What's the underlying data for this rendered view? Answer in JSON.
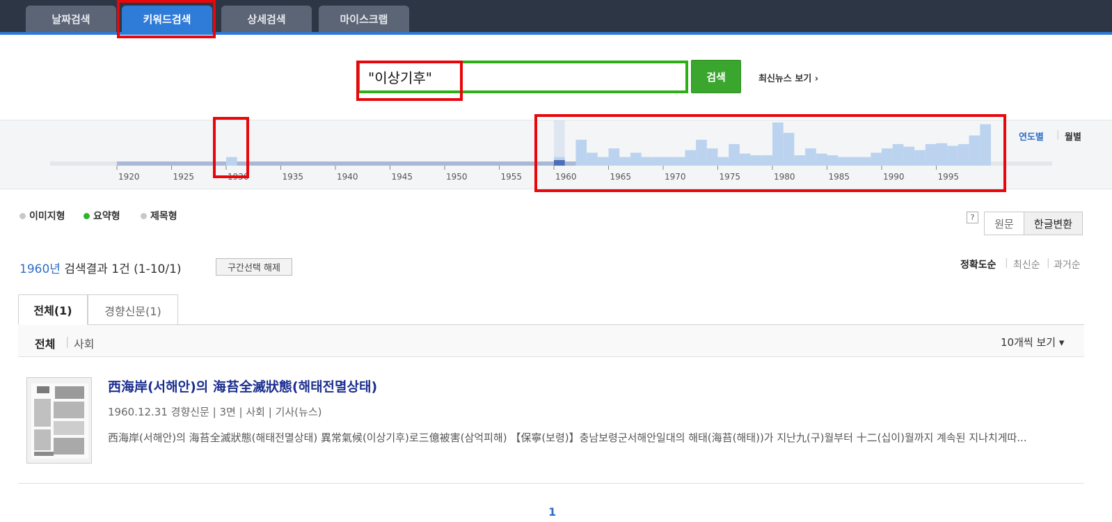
{
  "tabs": [
    {
      "label": "날짜검색"
    },
    {
      "label": "키워드검색"
    },
    {
      "label": "상세검색"
    },
    {
      "label": "마이스크랩"
    }
  ],
  "search": {
    "value": "\"이상기후\"",
    "button_label": "검색",
    "latest_link": "최신뉴스 보기 ›"
  },
  "timeline_toggle": {
    "yearly": "연도별",
    "monthly": "월별",
    "separator": "|"
  },
  "chart_data": {
    "type": "bar",
    "x": [
      1921,
      1922,
      1923,
      1924,
      1925,
      1926,
      1927,
      1928,
      1929,
      1930,
      1931,
      1932,
      1933,
      1934,
      1935,
      1936,
      1937,
      1938,
      1939,
      1940,
      1941,
      1942,
      1943,
      1944,
      1945,
      1946,
      1947,
      1948,
      1949,
      1950,
      1951,
      1952,
      1953,
      1954,
      1955,
      1956,
      1957,
      1958,
      1959,
      1960,
      1961,
      1962,
      1963,
      1964,
      1965,
      1966,
      1967,
      1968,
      1969,
      1970,
      1971,
      1972,
      1973,
      1974,
      1975,
      1976,
      1977,
      1978,
      1979,
      1980,
      1981,
      1982,
      1983,
      1984,
      1985,
      1986,
      1987,
      1988,
      1989,
      1990,
      1991,
      1992,
      1993,
      1994,
      1995,
      1996,
      1997,
      1998,
      1999
    ],
    "values": [
      0,
      0,
      0,
      0,
      0,
      0,
      0,
      0,
      0,
      1,
      0,
      0,
      0,
      0,
      0,
      0,
      0,
      0,
      0,
      0,
      0,
      0,
      0,
      0,
      0,
      0,
      0,
      0,
      0,
      0,
      0,
      0,
      0,
      0,
      0,
      0,
      0,
      0,
      0,
      1,
      0,
      3,
      1.5,
      1,
      2,
      1,
      1.5,
      1,
      1,
      1,
      1,
      1.8,
      3,
      2,
      1,
      2.5,
      1.4,
      1.2,
      1.2,
      5,
      3.8,
      1.2,
      2,
      1.4,
      1.2,
      1,
      1,
      1,
      1.5,
      2,
      2.5,
      2.2,
      1.8,
      2.5,
      2.6,
      2.3,
      2.5,
      3.5,
      4.8,
      3.6
    ],
    "selected_year": 1960,
    "tick_labels": [
      "1920",
      "1925",
      "1930",
      "1935",
      "1940",
      "1945",
      "1950",
      "1955",
      "1960",
      "1965",
      "1970",
      "1975",
      "1980",
      "1985",
      "1990",
      "1995"
    ],
    "xlim": [
      1920,
      2000
    ],
    "ylim": [
      0,
      5
    ],
    "bar_color": "#bcd3ef",
    "selected_color": "#4c6fb8"
  },
  "view_modes": [
    {
      "label": "이미지형",
      "selected": false
    },
    {
      "label": "요약형",
      "selected": true
    },
    {
      "label": "제목형",
      "selected": false
    }
  ],
  "help_label": "?",
  "text_mode": {
    "original": "원문",
    "hangul": "한글변환"
  },
  "results": {
    "year": "1960년",
    "summary": "검색결과 1건 (1-10/1)",
    "reset_label": "구간선택 해제"
  },
  "sort": {
    "accuracy": "정확도순",
    "latest": "최신순",
    "oldest": "과거순",
    "separator": "|"
  },
  "content_tabs": [
    {
      "label": "전체(1)"
    },
    {
      "label": "경향신문(1)"
    }
  ],
  "subfilter": {
    "all": "전체",
    "separator": "|",
    "society": "사회",
    "per_page": "10개씩 보기 ▾"
  },
  "article": {
    "title": "西海岸(서해안)의 海苔全滅狀態(해태전멸상태)",
    "meta": "1960.12.31 경향신문 | 3면 | 사회 | 기사(뉴스)",
    "snippet": "西海岸(서해안)의 海苔全滅狀態(해태전멸상태) 異常氣候(이상기후)로三億被害(삼억피해) 【保寧(보령)】충남보령군서해안일대의 해태(海苔(해태))가 지난九(구)월부터 十二(십이)월까지 계속된 지나치게따..."
  },
  "pagination": {
    "current": "1"
  },
  "colors": {
    "annotation_red": "#e8060b",
    "annotation_green": "#2dae15",
    "accent_blue": "#2f7bd8"
  }
}
